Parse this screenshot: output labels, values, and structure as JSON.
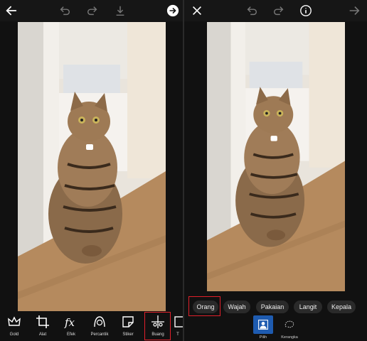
{
  "left_panel": {
    "toolbar_icons": [
      "back-arrow-icon",
      "undo-icon",
      "redo-icon",
      "download-icon",
      "next-arrow-circle-icon"
    ],
    "tools": [
      {
        "label": "Gold",
        "icon": "crown-icon"
      },
      {
        "label": "Alat",
        "icon": "crop-icon"
      },
      {
        "label": "Efek",
        "icon": "fx-icon"
      },
      {
        "label": "Percantik",
        "icon": "beautify-face-icon"
      },
      {
        "label": "Stiker",
        "icon": "sticker-icon"
      },
      {
        "label": "Buang",
        "icon": "remove-object-icon"
      },
      {
        "label": "T",
        "icon": "text-tool-icon"
      }
    ],
    "highlighted_tool": "Buang"
  },
  "right_panel": {
    "toolbar_icons": [
      "close-icon",
      "undo-icon",
      "redo-icon",
      "info-icon",
      "next-arrow-icon"
    ],
    "categories": [
      "Orang",
      "Wajah",
      "Pakaian",
      "Langit",
      "Kepala"
    ],
    "highlighted_category": "Orang",
    "modes": [
      {
        "label": "Pilih",
        "icon": "person-select-icon",
        "active": true
      },
      {
        "label": "Kerangka",
        "icon": "lasso-icon",
        "active": false
      }
    ]
  },
  "colors": {
    "accent_highlight": "#e0202a",
    "active_mode": "#1e5bb0",
    "background": "#111111"
  }
}
